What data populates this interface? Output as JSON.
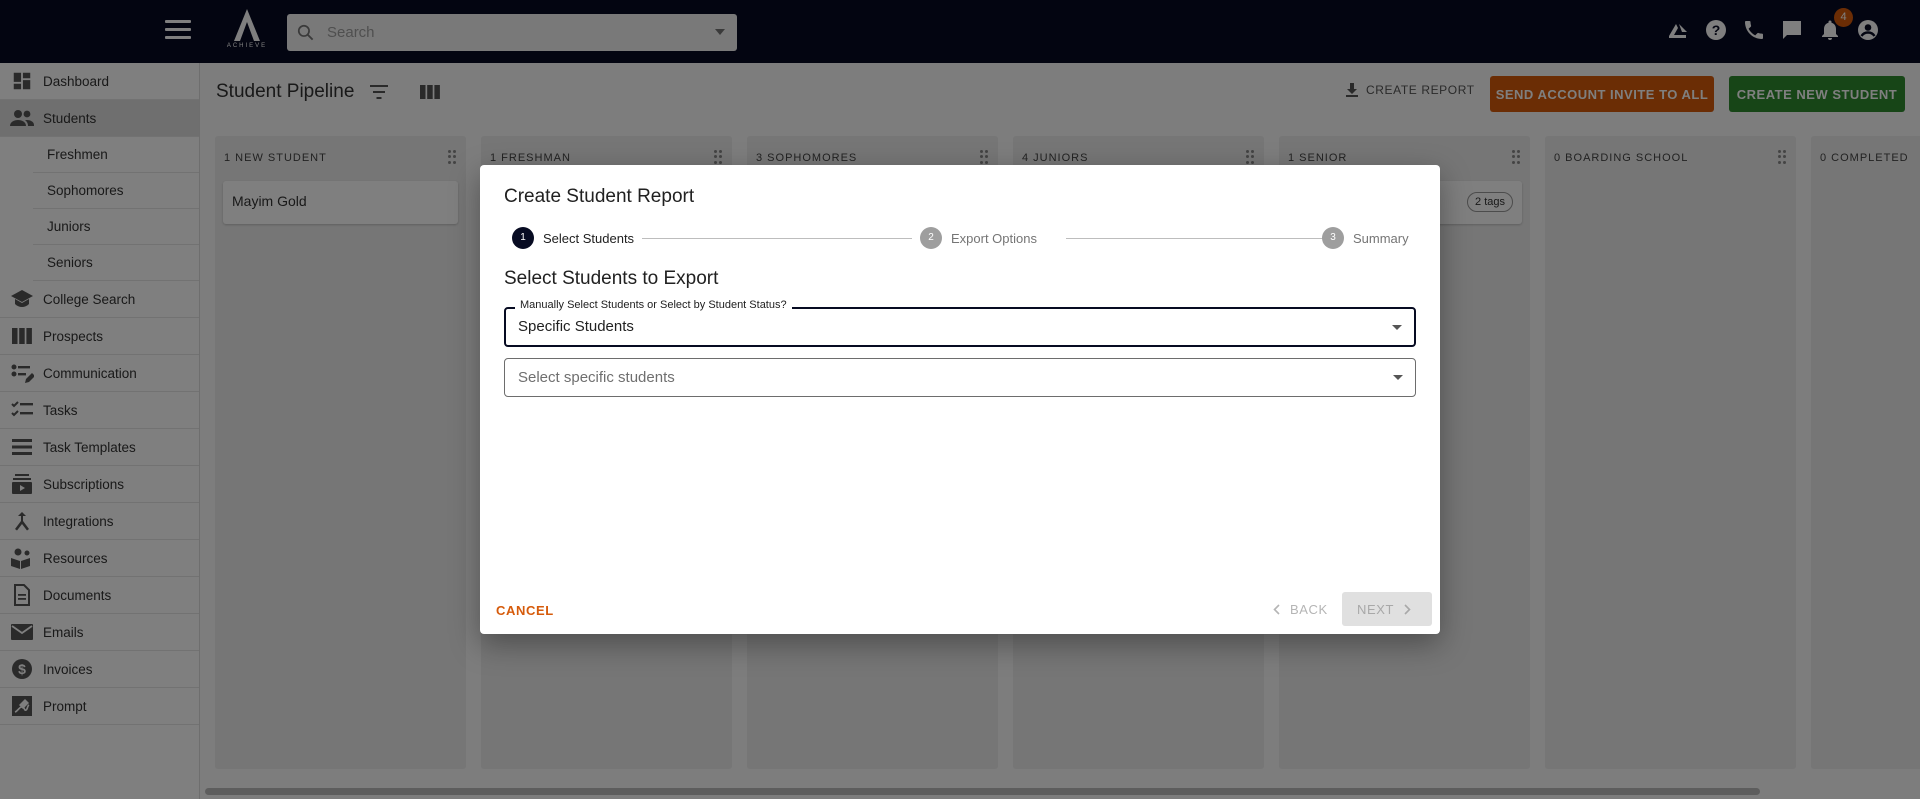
{
  "topbar": {
    "logo_text": "ACHIEVE",
    "search_placeholder": "Search",
    "notification_count": "4"
  },
  "sidebar": {
    "items": [
      {
        "label": "Dashboard",
        "icon": "dashboard-icon"
      },
      {
        "label": "Students",
        "icon": "people-icon",
        "active": true
      },
      {
        "label": "College Search",
        "icon": "school-icon"
      },
      {
        "label": "Prospects",
        "icon": "columns-icon"
      },
      {
        "label": "Communication",
        "icon": "communication-icon"
      },
      {
        "label": "Tasks",
        "icon": "checklist-icon"
      },
      {
        "label": "Task Templates",
        "icon": "list-icon"
      },
      {
        "label": "Subscriptions",
        "icon": "subscriptions-icon"
      },
      {
        "label": "Integrations",
        "icon": "merge-icon"
      },
      {
        "label": "Resources",
        "icon": "resources-icon"
      },
      {
        "label": "Documents",
        "icon": "document-icon"
      },
      {
        "label": "Emails",
        "icon": "mail-icon"
      },
      {
        "label": "Invoices",
        "icon": "dollar-icon"
      },
      {
        "label": "Prompt",
        "icon": "prompt-icon"
      }
    ],
    "student_subitems": [
      "Freshmen",
      "Sophomores",
      "Juniors",
      "Seniors"
    ]
  },
  "header": {
    "title": "Student Pipeline",
    "create_report": "CREATE REPORT",
    "invite_button": "SEND ACCOUNT INVITE TO ALL",
    "new_student_button": "CREATE NEW STUDENT"
  },
  "board": {
    "columns": [
      {
        "title": "1 NEW STUDENT",
        "card": "Mayim Gold"
      },
      {
        "title": "1 FRESHMAN"
      },
      {
        "title": "3 SOPHOMORES"
      },
      {
        "title": "4 JUNIORS"
      },
      {
        "title": "1 SENIOR",
        "tag": "2 tags"
      },
      {
        "title": "0 BOARDING SCHOOL"
      },
      {
        "title": "0 COMPLETED"
      }
    ]
  },
  "dialog": {
    "title": "Create Student Report",
    "steps": [
      {
        "num": "1",
        "label": "Select Students"
      },
      {
        "num": "2",
        "label": "Export Options"
      },
      {
        "num": "3",
        "label": "Summary"
      }
    ],
    "section_title": "Select Students to Export",
    "mode_field": {
      "label": "Manually Select Students or Select by Student Status?",
      "value": "Specific Students"
    },
    "students_field": {
      "placeholder": "Select specific students"
    },
    "cancel": "CANCEL",
    "back": "BACK",
    "next": "NEXT"
  },
  "colors": {
    "topbar": "#070b22",
    "accent_orange": "#d65b0b",
    "accent_green": "#2e8b2e"
  }
}
